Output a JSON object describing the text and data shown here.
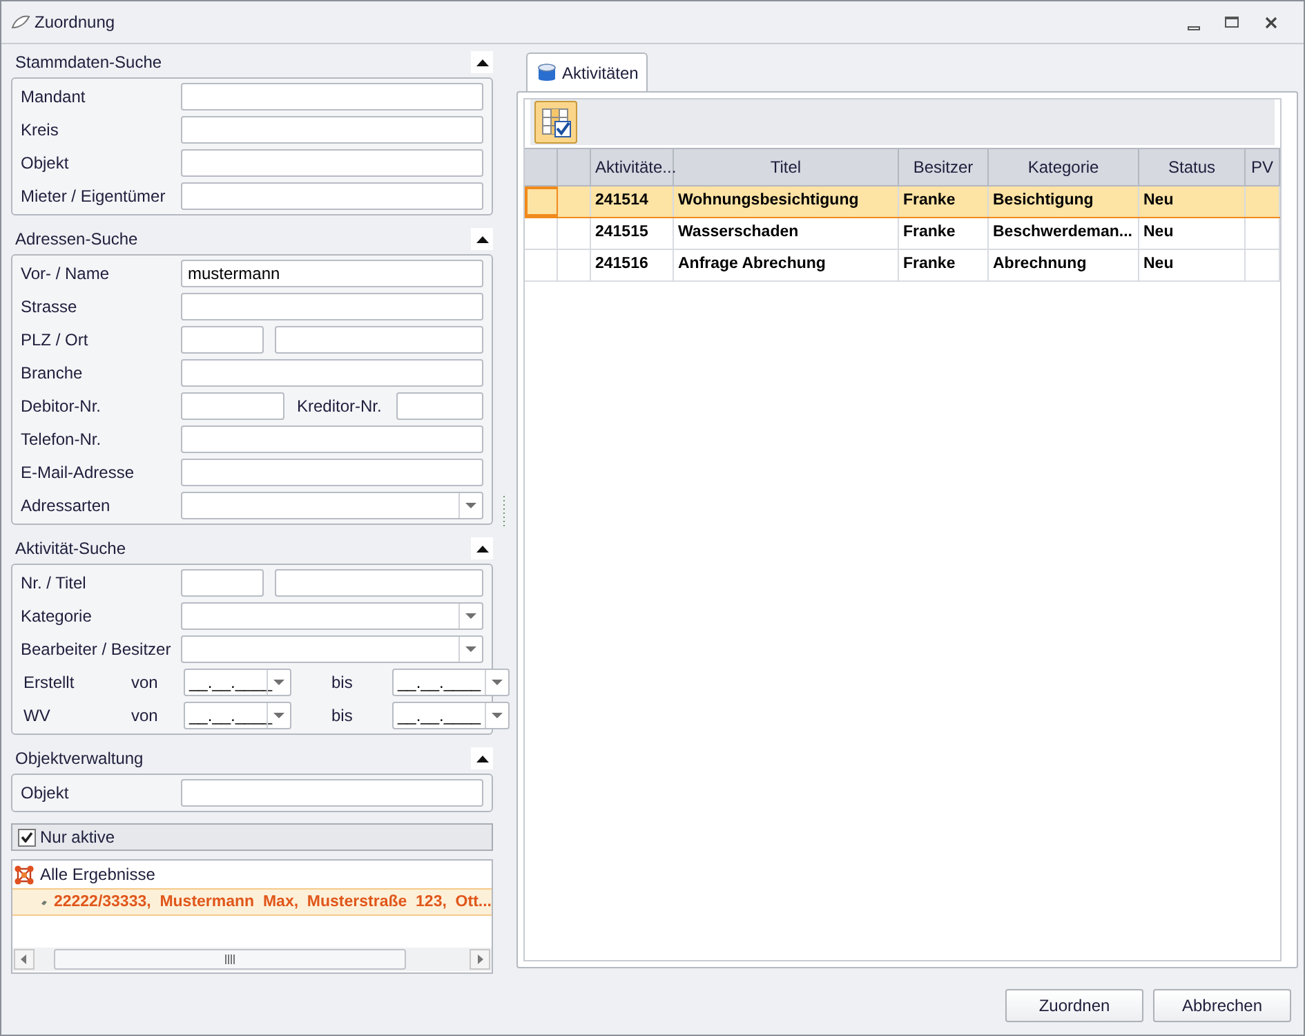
{
  "window": {
    "title": "Zuordnung"
  },
  "sections": [
    {
      "title": "Stammdaten-Suche",
      "expanded": true,
      "rows": [
        {
          "kind": "text",
          "label": "Mandant"
        },
        {
          "kind": "text",
          "label": "Kreis"
        },
        {
          "kind": "text",
          "label": "Objekt"
        },
        {
          "kind": "text",
          "label": "Mieter / Eigentümer"
        }
      ]
    },
    {
      "title": "Adressen-Suche",
      "expanded": true,
      "rows": [
        {
          "kind": "text",
          "label": "Vor- / Name",
          "value": "mustermann"
        },
        {
          "kind": "text",
          "label": "Strasse"
        },
        {
          "kind": "pair",
          "label": "PLZ / Ort"
        },
        {
          "kind": "text",
          "label": "Branche"
        },
        {
          "kind": "split",
          "label": "Debitor-Nr.",
          "label2": "Kreditor-Nr."
        },
        {
          "kind": "text",
          "label": "Telefon-Nr."
        },
        {
          "kind": "text",
          "label": "E-Mail-Adresse"
        },
        {
          "kind": "combo",
          "label": "Adressarten"
        }
      ]
    },
    {
      "title": "Aktivität-Suche",
      "expanded": true,
      "rows": [
        {
          "kind": "pair",
          "label": "Nr. / Titel"
        },
        {
          "kind": "combo",
          "label": "Kategorie"
        },
        {
          "kind": "combo",
          "label": "Bearbeiter / Besitzer"
        },
        {
          "kind": "date",
          "label": "Erstellt",
          "from_label": "von",
          "from": "__.__.____",
          "to_label": "bis",
          "to": "__.__.____"
        },
        {
          "kind": "date",
          "label": "WV",
          "from_label": "von",
          "from": "__.__.____",
          "to_label": "bis",
          "to": "__.__.____"
        }
      ]
    },
    {
      "title": "Objektverwaltung",
      "expanded": true,
      "rows": [
        {
          "kind": "text",
          "label": "Objekt"
        }
      ]
    }
  ],
  "only_active": {
    "label": "Nur aktive",
    "checked": true
  },
  "tree": {
    "label": "Alle Ergebnisse",
    "selected": false,
    "children": [
      {
        "label": "22222/33333,  Mustermann  Max,  Musterstraße  123,  Ott...",
        "selected": true
      }
    ]
  },
  "tabs": [
    {
      "label": "Aktivitäten",
      "selected": true
    }
  ],
  "table": {
    "columns": [
      "Aktivitäte...",
      "Titel",
      "Besitzer",
      "Kategorie",
      "Status",
      "PV"
    ],
    "rows": [
      {
        "selected": true,
        "cells": [
          "241514",
          "Wohnungsbesichtigung",
          "Franke",
          "Besichtigung",
          "Neu"
        ]
      },
      {
        "selected": false,
        "cells": [
          "241515",
          "Wasserschaden",
          "Franke",
          "Beschwerdeman...",
          "Neu"
        ]
      },
      {
        "selected": false,
        "cells": [
          "241516",
          "Anfrage Abrechung",
          "Franke",
          "Abrechnung",
          "Neu"
        ]
      }
    ]
  },
  "buttons": [
    "Zuordnen",
    "Abbrechen"
  ]
}
